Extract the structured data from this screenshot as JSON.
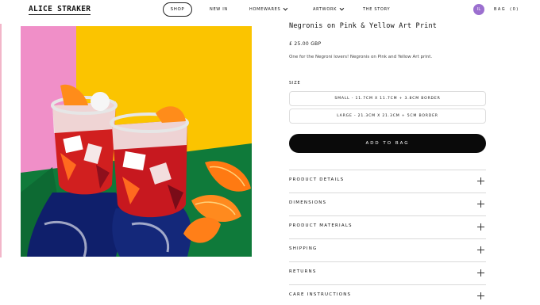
{
  "header": {
    "logo": "ALICE STRAKER",
    "nav": {
      "shop": "SHOP",
      "new_in": "NEW IN",
      "homewares": "HOMEWARES",
      "artwork": "ARTWORK",
      "story": "THE STORY"
    },
    "avatar_initials": "IL",
    "bag_label": "BAG",
    "bag_count": "(0)"
  },
  "product": {
    "title": "Negronis on Pink & Yellow Art Print",
    "price": "£ 25.00 GBP",
    "description": "One for the Negroni lovers! Negronis on Pink and Yellow Art print.",
    "size_label": "SIZE",
    "size_options": [
      "SMALL - 11.7CM X 11.7CM + 3.8CM BORDER",
      "LARGE - 21.3CM X 21.3CM + 5CM BORDER"
    ],
    "add_to_bag": "ADD TO BAG",
    "accordion": [
      "PRODUCT DETAILS",
      "DIMENSIONS",
      "PRODUCT MATERIALS",
      "SHIPPING",
      "RETURNS",
      "CARE INSTRUCTIONS"
    ]
  },
  "colors": {
    "pink": "#f08fc8",
    "yellow": "#fbc400",
    "green": "#0f7a3a",
    "avatar": "#9b6fcf",
    "button": "#0a0a0a"
  }
}
